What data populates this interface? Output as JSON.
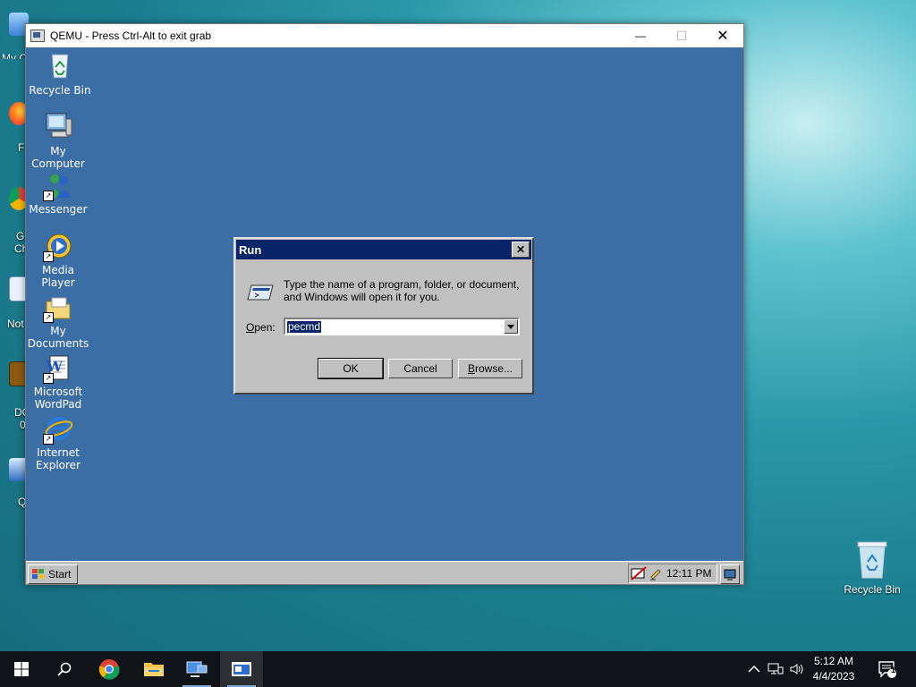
{
  "host": {
    "desktop_left_labels": [
      "My C",
      "F",
      "G",
      "Ch",
      "Not",
      "DO",
      "0",
      "Q"
    ],
    "recycle_bin_label": "Recycle Bin",
    "taskbar": {
      "apps": [
        {
          "name": "start",
          "icon": "windows-logo-icon"
        },
        {
          "name": "search",
          "icon": "search-icon"
        },
        {
          "name": "chrome",
          "icon": "chrome-icon"
        },
        {
          "name": "file-explorer",
          "icon": "folder-icon"
        },
        {
          "name": "network",
          "icon": "monitor-icon"
        },
        {
          "name": "qemu",
          "icon": "qemu-window-icon"
        }
      ],
      "clock_time": "5:12 AM",
      "clock_date": "4/4/2023",
      "notification_count": "1"
    }
  },
  "qemu": {
    "title": "QEMU - Press Ctrl-Alt to exit grab",
    "controls": {
      "minimize": "—",
      "maximize": "☐",
      "close": "✕"
    }
  },
  "guest": {
    "desktop_icons": [
      {
        "label": "Recycle Bin",
        "icon": "recycle-bin-icon"
      },
      {
        "label": "My\nComputer",
        "icon": "computer-icon"
      },
      {
        "label": "Messenger",
        "icon": "messenger-icon"
      },
      {
        "label": "Media Player",
        "icon": "media-player-icon"
      },
      {
        "label": "My\nDocuments",
        "icon": "folder-icon"
      },
      {
        "label": "Microsoft\nWordPad",
        "icon": "wordpad-icon"
      },
      {
        "label": "Internet\nExplorer",
        "icon": "ie-icon"
      }
    ],
    "taskbar": {
      "start_label": "Start",
      "time": "12:11 PM"
    },
    "run_dialog": {
      "title": "Run",
      "close": "✕",
      "description": "Type the name of a program, folder, or document, and Windows will open it for you.",
      "open_label_prefix": "O",
      "open_label_rest": "pen:",
      "open_value": "pecmd",
      "ok": "OK",
      "cancel": "Cancel",
      "browse_prefix": "B",
      "browse_rest": "rowse..."
    }
  }
}
